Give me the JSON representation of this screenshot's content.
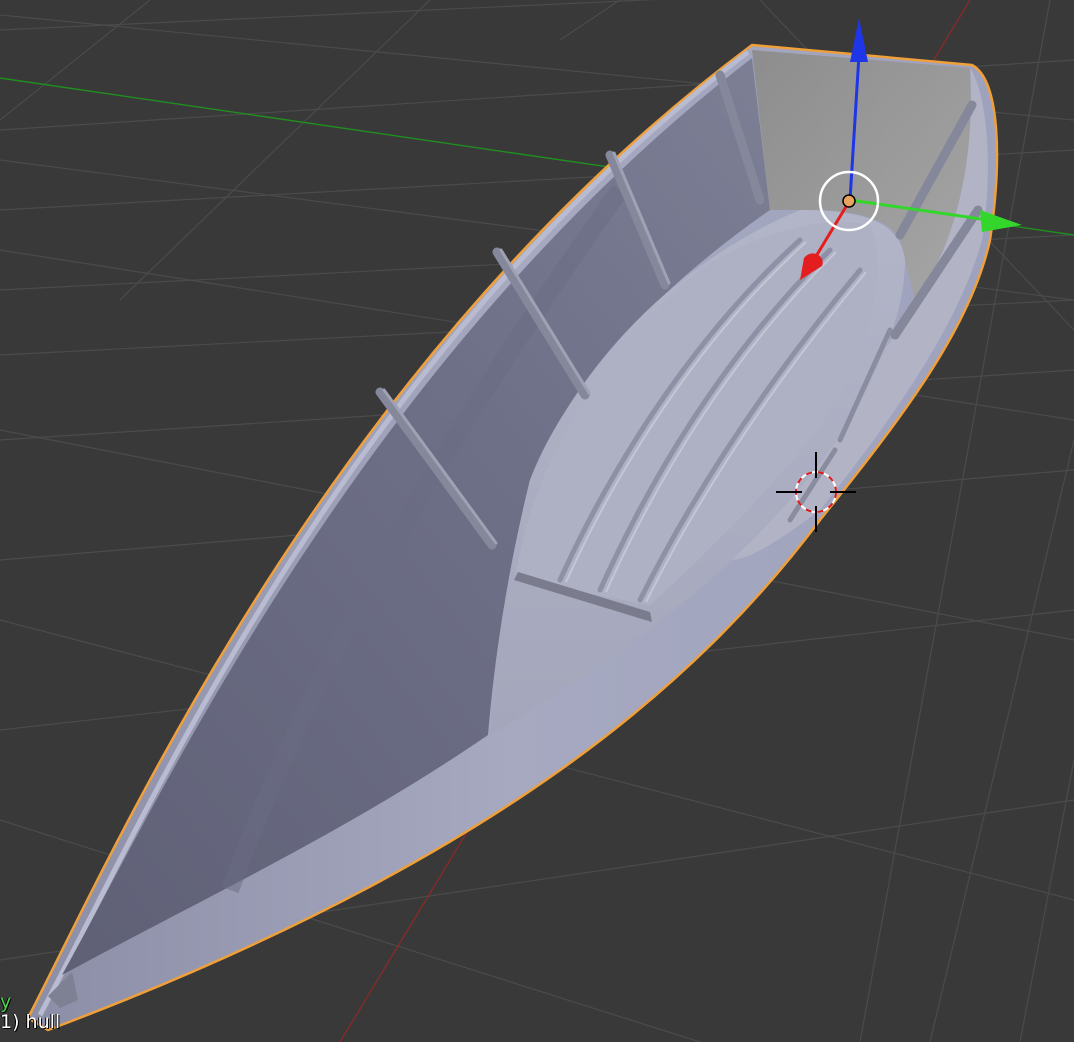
{
  "viewport": {
    "background_color": "#393939",
    "grid_color": "#4b4b4b",
    "x_axis_color": "#8a2a2a",
    "y_axis_color": "#1f8f1f",
    "selection_outline_color": "#f0a03a"
  },
  "overlay": {
    "axis_label": "y",
    "axis_label_color": "#4fd14f",
    "object_info": "1) hull"
  },
  "mesh": {
    "name": "hull",
    "material_color": "#a9abc2"
  },
  "gizmo": {
    "x_color": "#e41e1e",
    "y_color": "#33d62a",
    "z_color": "#1f35e8",
    "origin_color": "#e8a361"
  },
  "icons": {
    "cursor": "3d-cursor-icon",
    "origin": "object-origin-icon",
    "manipulator": "transform-manipulator-icon"
  }
}
